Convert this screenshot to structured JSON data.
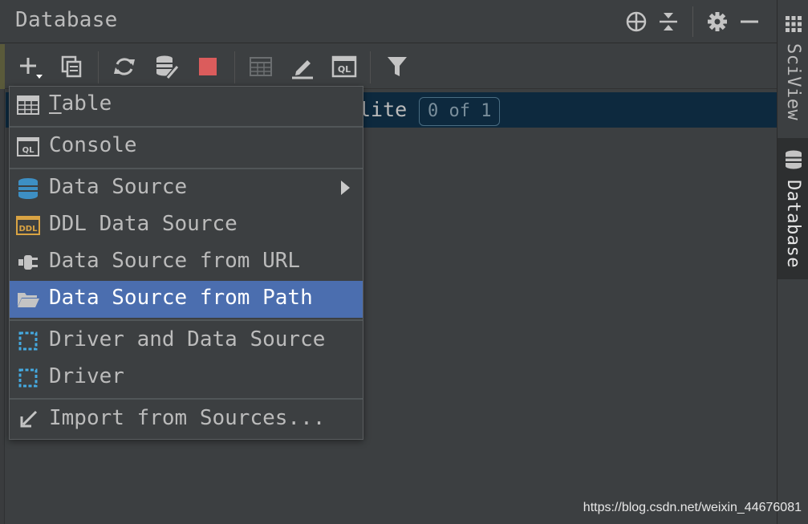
{
  "window": {
    "title": "Database"
  },
  "title_actions": [
    "crosshair-icon",
    "collapse-all-icon",
    "gear-icon",
    "minimize-icon"
  ],
  "toolbar": {
    "tools": [
      "add-icon",
      "duplicate-icon",
      "refresh-icon",
      "data-source-properties-icon",
      "stop-icon",
      "table-icon",
      "edit-icon",
      "query-console-icon",
      "filter-icon"
    ]
  },
  "tree": {
    "selected_label": "lite",
    "badge": "0 of 1"
  },
  "side_stripe": {
    "tabs": [
      {
        "label": "SciView",
        "icon": "grid-icon"
      },
      {
        "label": "Database",
        "icon": "database-icon"
      }
    ]
  },
  "menu": {
    "items": [
      {
        "label_first": "T",
        "label_rest": "able",
        "icon": "table-icon"
      },
      {
        "label": "Console",
        "icon": "console-ql-icon"
      },
      {
        "label": "Data Source",
        "icon": "database-icon",
        "submenu": true
      },
      {
        "label": "DDL Data Source",
        "icon": "ddl-icon"
      },
      {
        "label": "Data Source from URL",
        "icon": "plug-icon"
      },
      {
        "label": "Data Source from Path",
        "icon": "folder-icon",
        "selected": true
      },
      {
        "label": "Driver and Data Source",
        "icon": "driver-icon"
      },
      {
        "label": "Driver",
        "icon": "driver-icon"
      },
      {
        "label": "Import from Sources...",
        "icon": "import-arrow-icon"
      }
    ]
  },
  "colors": {
    "background": "#3c3f41",
    "selection": "#4b6eaf",
    "tree_selection": "#0d293e",
    "stop_red": "#db5c5c",
    "db_blue": "#3d8fc4"
  },
  "watermark": "https://blog.csdn.net/weixin_44676081"
}
